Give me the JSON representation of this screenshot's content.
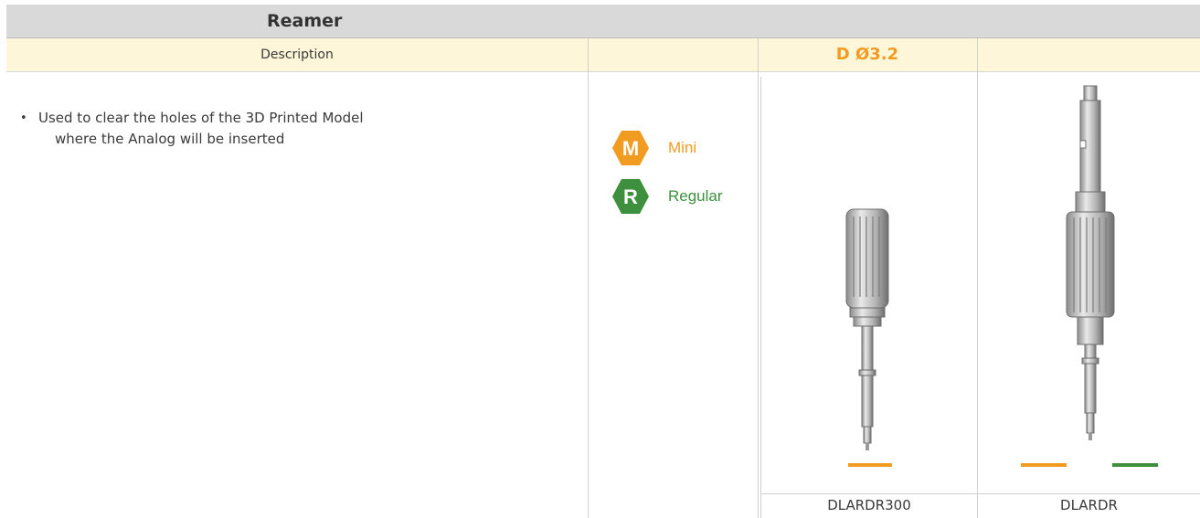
{
  "title": "Reamer",
  "header": {
    "description_label": "Description",
    "diameter_label": "D Ø3.2"
  },
  "description": {
    "bullet": "•",
    "line1": "Used to clear the holes of the 3D Printed Model",
    "line2": "where the Analog will be inserted"
  },
  "badges": [
    {
      "letter": "M",
      "label": "Mini",
      "color": "#f29b21"
    },
    {
      "letter": "R",
      "label": "Regular",
      "color": "#3e8f3e"
    }
  ],
  "products": [
    {
      "code": "DLARDR300",
      "icon": "reamer-short-icon",
      "swatches": [
        "#f29b21"
      ]
    },
    {
      "code": "DLARDR",
      "icon": "reamer-long-icon",
      "swatches": [
        "#f29b21",
        "#3e8f3e"
      ]
    }
  ]
}
